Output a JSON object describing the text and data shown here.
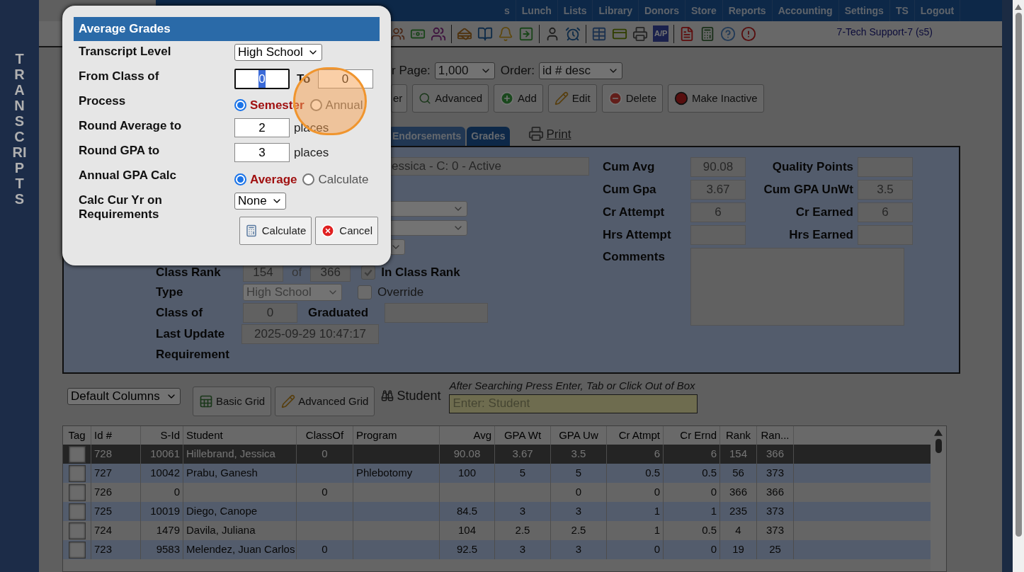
{
  "sidebar": {
    "title": "TRANSCRIPTS"
  },
  "nav": {
    "items": [
      "s",
      "Lunch",
      "Lists",
      "Library",
      "Donors",
      "Store",
      "Reports",
      "Accounting",
      "Settings",
      "TS",
      "Logout"
    ]
  },
  "toolbar": {
    "ap_icon_text": "A/P",
    "user": "7-Tech Support-7 (s5)"
  },
  "paging": {
    "per_page_label": "r Page:",
    "per_page": "1,000",
    "order_label": "Order:",
    "order": "id # desc"
  },
  "actions": [
    {
      "kind": "plain",
      "label": "er"
    },
    {
      "kind": "advanced",
      "label": "Advanced"
    },
    {
      "kind": "add",
      "label": "Add"
    },
    {
      "kind": "edit",
      "label": "Edit"
    },
    {
      "kind": "delete",
      "label": "Delete"
    },
    {
      "kind": "inactive",
      "label": "Make Inactive"
    }
  ],
  "tabs": [
    {
      "label": "Endorsements",
      "selected": false
    },
    {
      "label": "Grades",
      "selected": true
    }
  ],
  "print_link": "Print",
  "record": {
    "name": "essica - C: 0 - Active",
    "class_rank_label": "Class Rank",
    "class_rank": "154",
    "of_label": "of",
    "class_total": "366",
    "in_class_rank": {
      "label": "In Class Rank",
      "checked": true
    },
    "type_label": "Type",
    "type": "High School",
    "override": {
      "label": "Override",
      "checked": false
    },
    "class_of_label": "Class of",
    "class_of": "0",
    "graduated_label": "Graduated",
    "last_update_label": "Last Update",
    "last_update": "2025-09-29 10:47:17",
    "requirement_label": "Requirement"
  },
  "stats": [
    {
      "label": "Cum Avg",
      "value": "90.08"
    },
    {
      "label": "Quality Points"
    },
    {
      "label": "Cum Gpa",
      "value": "3.67"
    },
    {
      "label": "Cum GPA UnWt",
      "value": "3.5"
    },
    {
      "label": "Cr Attempt",
      "value": "6"
    },
    {
      "label": "Cr Earned",
      "value": "6"
    },
    {
      "label": "Hrs Attempt"
    },
    {
      "label": "Hrs Earned"
    }
  ],
  "comments_label": "Comments",
  "grid_toolbar": {
    "columns_select": "Default Columns",
    "buttons": [
      {
        "kind": "basic",
        "label": "Basic Grid"
      },
      {
        "kind": "advanced",
        "label": "Advanced Grid"
      }
    ],
    "search_label": "Student",
    "search_hint": "After Searching Press Enter, Tab or Click Out of Box",
    "search_placeholder": "Enter: Student"
  },
  "table": {
    "columns": [
      "Tag",
      "Id #",
      "S-Id",
      "Student",
      "ClassOf",
      "Program",
      "Avg",
      "GPA Wt",
      "GPA Uw",
      "Cr Atmpt",
      "Cr Ernd",
      "Rank",
      "Ran..."
    ],
    "rows": [
      {
        "selected": true,
        "tagged": false,
        "id": "728",
        "s_id": "10061",
        "student": "Hillebrand, Jessica",
        "class_of": "0",
        "avg": "90.08",
        "gpa_wt": "3.67",
        "gpa_uw": "3.5",
        "cr_atmpt": "6",
        "cr_ernd": "6",
        "rank": "154",
        "rank_total": "366"
      },
      {
        "selected": false,
        "tagged": false,
        "id": "727",
        "s_id": "10042",
        "student": "Prabu, Ganesh",
        "program": "Phlebotomy",
        "avg": "100",
        "gpa_wt": "5",
        "gpa_uw": "5",
        "cr_atmpt": "0.5",
        "cr_ernd": "0.5",
        "rank": "56",
        "rank_total": "373"
      },
      {
        "selected": false,
        "tagged": false,
        "id": "726",
        "s_id": "0",
        "class_of": "0",
        "gpa_uw": "0",
        "cr_atmpt": "0",
        "cr_ernd": "0",
        "rank": "366",
        "rank_total": "366"
      },
      {
        "selected": false,
        "tagged": false,
        "id": "725",
        "s_id": "10019",
        "student": "Diego, Canope",
        "avg": "84.5",
        "gpa_wt": "3",
        "gpa_uw": "3",
        "cr_atmpt": "1",
        "cr_ernd": "1",
        "rank": "235",
        "rank_total": "373"
      },
      {
        "selected": false,
        "tagged": false,
        "id": "724",
        "s_id": "1479",
        "student": "Davila, Juliana",
        "avg": "104",
        "gpa_wt": "2.5",
        "gpa_uw": "2.5",
        "cr_atmpt": "1",
        "cr_ernd": "0.5",
        "rank": "4",
        "rank_total": "373"
      },
      {
        "selected": false,
        "tagged": false,
        "id": "723",
        "s_id": "9583",
        "student": "Melendez, Juan Carlos",
        "class_of": "0",
        "avg": "92.5",
        "gpa_wt": "3",
        "gpa_uw": "3",
        "cr_atmpt": "0",
        "cr_ernd": "0",
        "rank": "19",
        "rank_total": "25"
      }
    ]
  },
  "dialog": {
    "title": "Average Grades",
    "fields": [
      {
        "kind": "select",
        "label": "Transcript Level",
        "value": "High School"
      },
      {
        "kind": "range",
        "label": "From Class of",
        "from": "0",
        "to_label": "To",
        "to": "0"
      },
      {
        "kind": "radio",
        "label": "Process",
        "options": [
          {
            "label": "Semester",
            "selected": true
          },
          {
            "label": "Annual",
            "selected": false
          }
        ]
      },
      {
        "kind": "number",
        "label": "Round Average to",
        "value": "2",
        "unit": "places"
      },
      {
        "kind": "number",
        "label": "Round GPA to",
        "value": "3",
        "unit": "places"
      },
      {
        "kind": "radio",
        "label": "Annual GPA Calc",
        "options": [
          {
            "label": "Average",
            "selected": true
          },
          {
            "label": "Calculate",
            "selected": false
          }
        ]
      },
      {
        "kind": "select",
        "label": "Calc Cur Yr on Requirements",
        "value": "None"
      }
    ],
    "buttons": [
      {
        "kind": "calculate",
        "label": "Calculate"
      },
      {
        "kind": "cancel",
        "label": "Cancel"
      }
    ]
  }
}
